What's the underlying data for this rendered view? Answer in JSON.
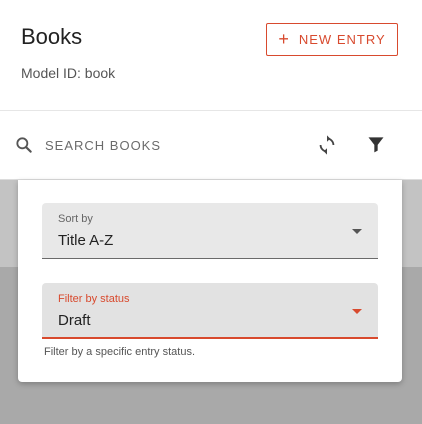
{
  "header": {
    "title": "Books",
    "subtitle": "Model ID: book",
    "new_entry_label": "NEW ENTRY",
    "new_entry_icon": "plus-icon",
    "accent_color": "#d84a2e"
  },
  "toolbar": {
    "search_placeholder": "SEARCH BOOKS",
    "search_icon": "search-icon",
    "refresh_icon": "refresh-icon",
    "filter_icon": "filter-icon"
  },
  "filters": {
    "sort": {
      "label": "Sort by",
      "value": "Title A-Z"
    },
    "status": {
      "label": "Filter by status",
      "value": "Draft",
      "helper": "Filter by a specific entry status."
    }
  }
}
